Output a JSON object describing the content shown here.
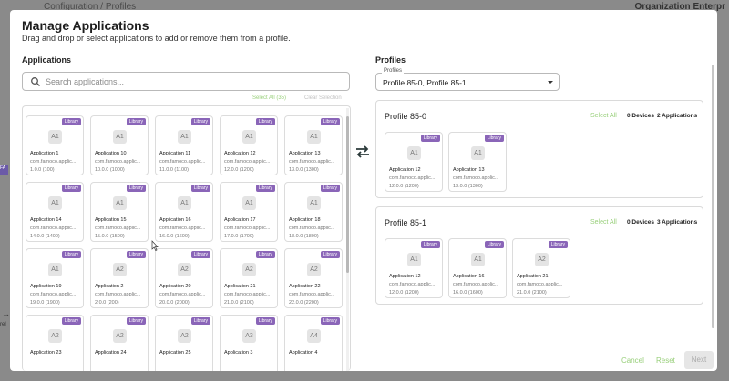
{
  "background": {
    "breadcrumb": "Configuration / Profiles",
    "org": "Organization Enterpr",
    "side_badge": "FA",
    "side_label": "rel",
    "side_arrow": "→"
  },
  "modal": {
    "title": "Manage Applications",
    "subtitle": "Drag and drop or select applications to add or remove them from a profile."
  },
  "applications": {
    "heading": "Applications",
    "search_placeholder": "Search applications...",
    "select_all": "Select All (35)",
    "clear_selection": "Clear Selection",
    "badge": "Library",
    "items": [
      {
        "avatar": "A1",
        "name": "Application 1",
        "pkg": "com.famoco.applic...",
        "ver": "1.0.0 (100)"
      },
      {
        "avatar": "A1",
        "name": "Application 10",
        "pkg": "com.famoco.applic...",
        "ver": "10.0.0 (1000)"
      },
      {
        "avatar": "A1",
        "name": "Application 11",
        "pkg": "com.famoco.applic...",
        "ver": "11.0.0 (1100)"
      },
      {
        "avatar": "A1",
        "name": "Application 12",
        "pkg": "com.famoco.applic...",
        "ver": "12.0.0 (1200)"
      },
      {
        "avatar": "A1",
        "name": "Application 13",
        "pkg": "com.famoco.applic...",
        "ver": "13.0.0 (1300)"
      },
      {
        "avatar": "A1",
        "name": "Application 14",
        "pkg": "com.famoco.applic...",
        "ver": "14.0.0 (1400)"
      },
      {
        "avatar": "A1",
        "name": "Application 15",
        "pkg": "com.famoco.applic...",
        "ver": "15.0.0 (1500)"
      },
      {
        "avatar": "A1",
        "name": "Application 16",
        "pkg": "com.famoco.applic...",
        "ver": "16.0.0 (1600)"
      },
      {
        "avatar": "A1",
        "name": "Application 17",
        "pkg": "com.famoco.applic...",
        "ver": "17.0.0 (1700)"
      },
      {
        "avatar": "A1",
        "name": "Application 18",
        "pkg": "com.famoco.applic...",
        "ver": "18.0.0 (1800)"
      },
      {
        "avatar": "A1",
        "name": "Application 19",
        "pkg": "com.famoco.applic...",
        "ver": "19.0.0 (1900)"
      },
      {
        "avatar": "A2",
        "name": "Application 2",
        "pkg": "com.famoco.applic...",
        "ver": "2.0.0 (200)"
      },
      {
        "avatar": "A2",
        "name": "Application 20",
        "pkg": "com.famoco.applic...",
        "ver": "20.0.0 (2000)"
      },
      {
        "avatar": "A2",
        "name": "Application 21",
        "pkg": "com.famoco.applic...",
        "ver": "21.0.0 (2100)"
      },
      {
        "avatar": "A2",
        "name": "Application 22",
        "pkg": "com.famoco.applic...",
        "ver": "22.0.0 (2200)"
      },
      {
        "avatar": "A2",
        "name": "Application 23",
        "pkg": "",
        "ver": ""
      },
      {
        "avatar": "A2",
        "name": "Application 24",
        "pkg": "",
        "ver": ""
      },
      {
        "avatar": "A2",
        "name": "Application 25",
        "pkg": "",
        "ver": ""
      },
      {
        "avatar": "A3",
        "name": "Application 3",
        "pkg": "",
        "ver": ""
      },
      {
        "avatar": "A4",
        "name": "Application 4",
        "pkg": "",
        "ver": ""
      }
    ]
  },
  "profiles": {
    "heading": "Profiles",
    "field_label": "Profiles",
    "field_value": "Profile 85-0, Profile 85-1",
    "cards": [
      {
        "name": "Profile 85-0",
        "select_all": "Select All",
        "devices": "0 Devices",
        "apps_count": "2 Applications",
        "apps": [
          {
            "avatar": "A1",
            "name": "Application 12",
            "pkg": "com.famoco.applic...",
            "ver": "12.0.0 (1200)"
          },
          {
            "avatar": "A1",
            "name": "Application 13",
            "pkg": "com.famoco.applic...",
            "ver": "13.0.0 (1300)"
          }
        ]
      },
      {
        "name": "Profile 85-1",
        "select_all": "Select All",
        "devices": "0 Devices",
        "apps_count": "3 Applications",
        "apps": [
          {
            "avatar": "A1",
            "name": "Application 12",
            "pkg": "com.famoco.applic...",
            "ver": "12.0.0 (1200)"
          },
          {
            "avatar": "A1",
            "name": "Application 16",
            "pkg": "com.famoco.applic...",
            "ver": "16.0.0 (1600)"
          },
          {
            "avatar": "A2",
            "name": "Application 21",
            "pkg": "com.famoco.applic...",
            "ver": "21.0.0 (2100)"
          }
        ]
      }
    ]
  },
  "footer": {
    "cancel": "Cancel",
    "reset": "Reset",
    "next": "Next"
  },
  "colors": {
    "accent_green": "#98cf7a",
    "library_badge": "#8a65b8"
  }
}
